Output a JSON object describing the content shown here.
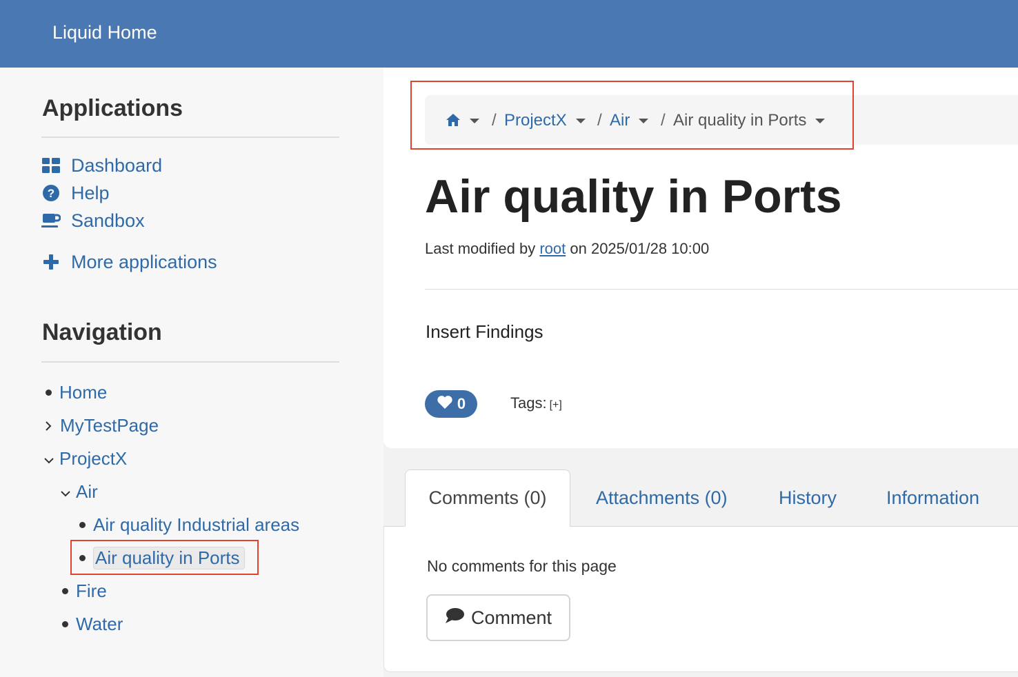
{
  "header": {
    "brand": "Liquid Home"
  },
  "sidebar": {
    "applications": {
      "title": "Applications",
      "items": [
        {
          "label": "Dashboard",
          "icon": "dashboard-icon"
        },
        {
          "label": "Help",
          "icon": "help-icon"
        },
        {
          "label": "Sandbox",
          "icon": "coffee-cup-icon"
        }
      ],
      "more": {
        "label": "More applications",
        "icon": "plus-icon"
      }
    },
    "navigation": {
      "title": "Navigation",
      "items": [
        {
          "label": "Home",
          "marker": "bullet"
        },
        {
          "label": "MyTestPage",
          "marker": "chevron-right"
        },
        {
          "label": "ProjectX",
          "marker": "chevron-down"
        },
        {
          "label": "Air",
          "marker": "chevron-down"
        },
        {
          "label": "Air quality Industrial areas",
          "marker": "bullet"
        },
        {
          "label": "Air quality in Ports",
          "marker": "bullet",
          "selected": true
        },
        {
          "label": "Fire",
          "marker": "bullet"
        },
        {
          "label": "Water",
          "marker": "bullet"
        }
      ]
    }
  },
  "breadcrumb": {
    "home_icon": "home-icon",
    "items": [
      {
        "label": "ProjectX"
      },
      {
        "label": "Air"
      },
      {
        "label": "Air quality in Ports",
        "current": true
      }
    ],
    "separator": "/"
  },
  "page": {
    "title": "Air quality in Ports",
    "modified_prefix": "Last modified by",
    "modified_user": "root",
    "modified_on": "on 2025/01/28 10:00",
    "body": "Insert Findings",
    "likes": "0",
    "tags_label": "Tags:",
    "tags_add": "[+]"
  },
  "tabs": [
    {
      "label": "Comments (0)",
      "active": true
    },
    {
      "label": "Attachments (0)"
    },
    {
      "label": "History"
    },
    {
      "label": "Information"
    }
  ],
  "comments": {
    "empty_text": "No comments for this page",
    "button_label": "Comment"
  },
  "colors": {
    "header_bg": "#4a78b3",
    "link": "#2f6aa8",
    "highlight_box": "#e2412f",
    "like_button": "#3e6ea8"
  }
}
